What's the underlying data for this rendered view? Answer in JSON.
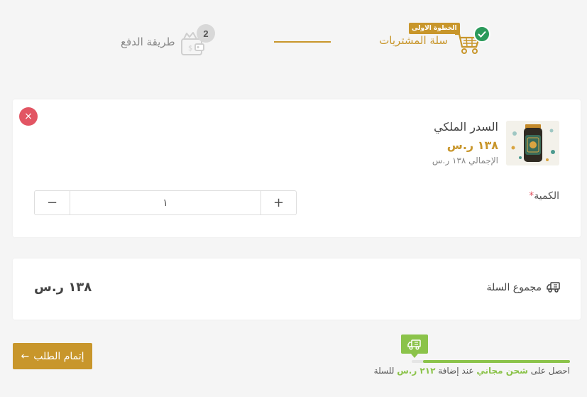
{
  "stepper": {
    "step1": {
      "badge": "الخطوة الاولى",
      "label": "سلة المشتريات"
    },
    "step2": {
      "number": "2",
      "label": "طريقة الدفع"
    }
  },
  "product": {
    "remove_symbol": "×",
    "name": "السدر الملكي",
    "price": "١٣٨ ر.س",
    "total": "الإجمالي ١٣٨ ر.س",
    "quantity_label": "الكمية",
    "required_mark": "*",
    "quantity_value": "١",
    "minus": "−",
    "plus": "+"
  },
  "summary": {
    "label": "مجموع السلة",
    "total": "١٣٨ ر.س"
  },
  "checkout": {
    "label": "إتمام الطلب",
    "arrow": "←"
  },
  "shipping": {
    "part1": "احصل على",
    "free_shipping": "شحن مجاني",
    "part2": "عند إضافة",
    "amount": "٢١٢ ر.س",
    "part3": "للسلة",
    "progress": 0.93
  },
  "colors": {
    "accent": "#c8962b",
    "success": "#2b9a5b",
    "danger": "#e25563",
    "shipping": "#8bc34a"
  }
}
